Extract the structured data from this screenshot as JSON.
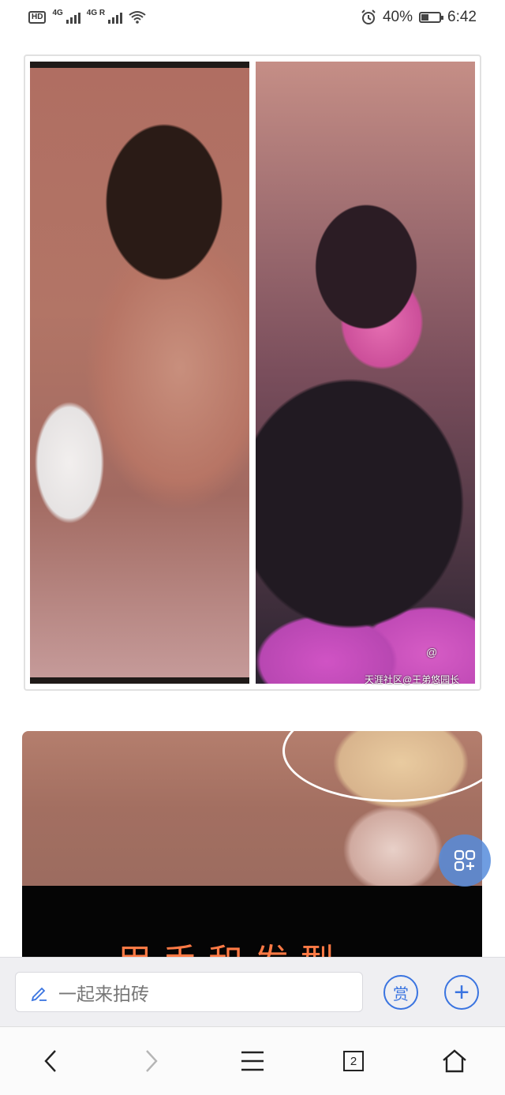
{
  "status_bar": {
    "hd_label": "HD",
    "network_1": "4G",
    "network_2": "4G R",
    "battery_percent": "40%",
    "battery_level": 0.4,
    "time": "6:42",
    "icons": [
      "alarm-icon",
      "wifi-icon",
      "signal-icon",
      "battery-icon"
    ]
  },
  "post": {
    "collage_watermark_line1": "@",
    "collage_watermark_line2": "天涯社区@王弟悠园长",
    "image2_caption": "用手和发型"
  },
  "floating_button": {
    "icon": "grid-apps-icon"
  },
  "comment_bar": {
    "placeholder": "一起来拍砖",
    "reward_label": "赏",
    "plus_label": "+"
  },
  "nav": {
    "back_icon": "chevron-left-icon",
    "forward_icon": "chevron-right-icon",
    "menu_icon": "menu-icon",
    "tabs_count": "2",
    "home_icon": "home-icon"
  },
  "colors": {
    "accent": "#3a74e0",
    "fab": "#568cdc",
    "caption": "#ff7a45"
  }
}
